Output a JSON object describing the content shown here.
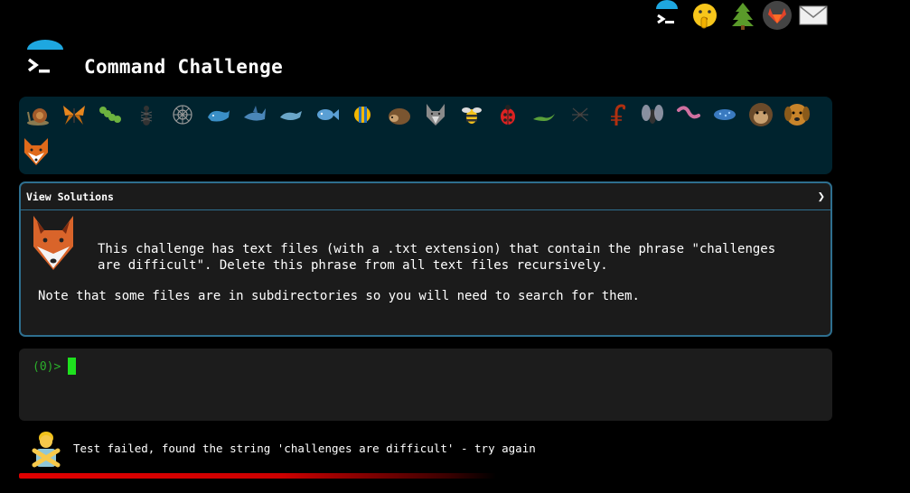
{
  "header": {
    "title": "Command Challenge"
  },
  "top_icons": [
    "terminal-icon",
    "shushing-face-icon",
    "evergreen-tree-icon",
    "gitlab-icon",
    "envelope-icon"
  ],
  "animals": [
    "snail",
    "butterfly",
    "caterpillar",
    "ant",
    "spider-web",
    "whale",
    "shark",
    "dolphin",
    "fish",
    "tropical-fish",
    "hedgehog",
    "wolf",
    "bee",
    "lady-beetle",
    "lizard",
    "spider",
    "scorpion",
    "fly",
    "worm",
    "microbe",
    "monkey",
    "dog",
    "fox"
  ],
  "panel": {
    "title": "View Solutions",
    "description_1": "This challenge has text files (with a .txt extension) that contain the phrase \"challenges are difficult\". Delete this phrase from all text files recursively.",
    "description_2": "Note that some files are in subdirectories so you will need to search for them."
  },
  "terminal": {
    "prompt": "(0)>"
  },
  "status": {
    "message": "Test failed, found the string 'challenges are difficult' - try again"
  },
  "colors": {
    "accent": "#2e6f8f",
    "animal_bar": "#00232e",
    "prompt": "#2bb02b",
    "error": "#e00000"
  }
}
